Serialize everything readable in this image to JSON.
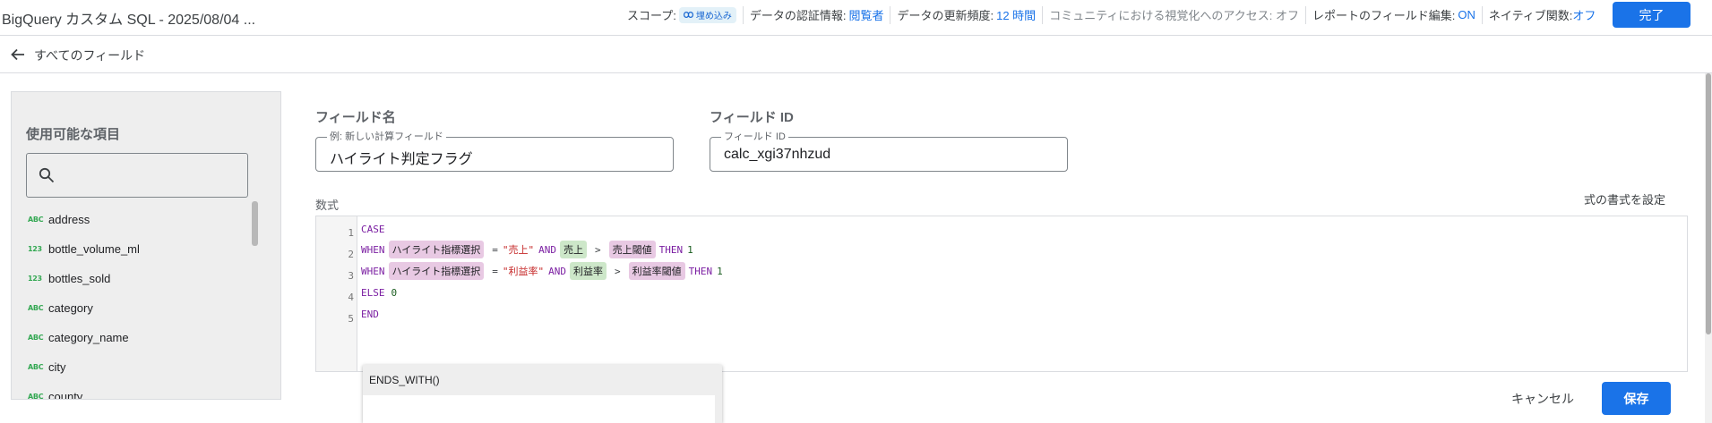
{
  "header": {
    "title": "BigQuery カスタム SQL - 2025/08/04 ...",
    "scope_label": "スコープ:",
    "scope_badge": "埋め込み",
    "credentials_label": "データの認証情報:",
    "credentials_value": "閲覧者",
    "freshness_label": "データの更新頻度:",
    "freshness_value": "12 時間",
    "community_access": "コミュニティにおける視覚化へのアクセス: オフ",
    "report_field_edit_label": "レポートのフィールド編集:",
    "report_field_edit_value": "ON",
    "native_functions_label": "ネイティブ関数:",
    "native_functions_value": "オフ",
    "done_label": "完了"
  },
  "subbar": {
    "back_label": "すべてのフィールド"
  },
  "left_panel": {
    "heading": "使用可能な項目",
    "search_placeholder": "",
    "fields": [
      {
        "type": "ABC",
        "name": "address"
      },
      {
        "type": "123",
        "name": "bottle_volume_ml"
      },
      {
        "type": "123",
        "name": "bottles_sold"
      },
      {
        "type": "ABC",
        "name": "category"
      },
      {
        "type": "ABC",
        "name": "category_name"
      },
      {
        "type": "ABC",
        "name": "city"
      },
      {
        "type": "ABC",
        "name": "county"
      }
    ]
  },
  "form": {
    "field_name_label": "フィールド名",
    "field_name_legend": "例: 新しい計算フィールド",
    "field_name_value": "ハイライト判定フラグ",
    "field_id_label": "フィールド ID",
    "field_id_legend": "フィールド ID",
    "field_id_value": "calc_xgi37nhzud",
    "formula_label": "数式",
    "format_link": "式の書式を設定"
  },
  "editor": {
    "line_numbers": [
      "1",
      "2",
      "3",
      "4",
      "5"
    ],
    "line1": {
      "kw": "CASE"
    },
    "line2": {
      "when": "WHEN",
      "chip1": "ハイライト指標選択",
      "eq": "=",
      "str": "\"売上\"",
      "and": "AND",
      "chip2": "売上",
      "gt": ">",
      "chip3": "売上閾値",
      "then": "THEN",
      "num": "1"
    },
    "line3": {
      "when": "WHEN",
      "chip1": "ハイライト指標選択",
      "eq": "=",
      "str": "\"利益率\"",
      "and": "AND",
      "chip2": "利益率",
      "gt": ">",
      "chip3": "利益率閾値",
      "then": "THEN",
      "num": "1"
    },
    "line4": {
      "kw": "ELSE",
      "num": "0"
    },
    "line5": {
      "kw": "END"
    }
  },
  "autocomplete": {
    "items": [
      "ENDS_WITH()"
    ]
  },
  "actions": {
    "cancel_label": "キャンセル",
    "save_label": "保存"
  }
}
